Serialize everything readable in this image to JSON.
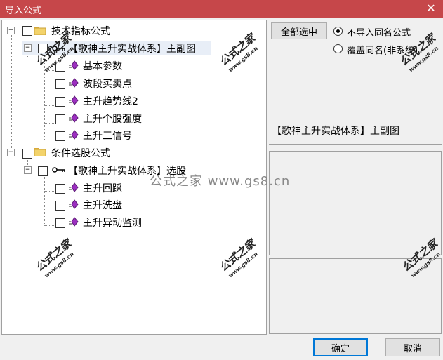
{
  "window": {
    "title": "导入公式",
    "close_glyph": "✕"
  },
  "tree": {
    "groups": [
      {
        "label": "技术指标公式",
        "expander": "−",
        "formula": {
          "label": "【歌神主升实战体系】主副图",
          "expander": "−"
        },
        "children": [
          "基本参数",
          "波段买卖点",
          "主升趋势线2",
          "主升个股强度",
          "主升三信号"
        ]
      },
      {
        "label": "条件选股公式",
        "expander": "−",
        "formula": {
          "label": "【歌神主升实战体系】选股",
          "expander": "−"
        },
        "children": [
          "主升回踩",
          "主升洗盘",
          "主升异动监测"
        ]
      }
    ]
  },
  "right_panel": {
    "select_all_label": "全部选中",
    "radio_options": [
      {
        "label": "不导入同名公式",
        "checked": true
      },
      {
        "label": "覆盖同名(非系统)",
        "checked": false
      }
    ],
    "selected_name": "【歌神主升实战体系】主副图"
  },
  "footer": {
    "ok_label": "确定",
    "cancel_label": "取消"
  },
  "watermark": {
    "brand": "公式之家",
    "domain": "www.gs8.cn",
    "center_text": "公式之家 www.gs8.cn"
  },
  "colors": {
    "titlebar": "#c6474a",
    "gem": "#9b2fbf",
    "folder": "#f3d36b",
    "default_button_border": "#0078d7"
  }
}
